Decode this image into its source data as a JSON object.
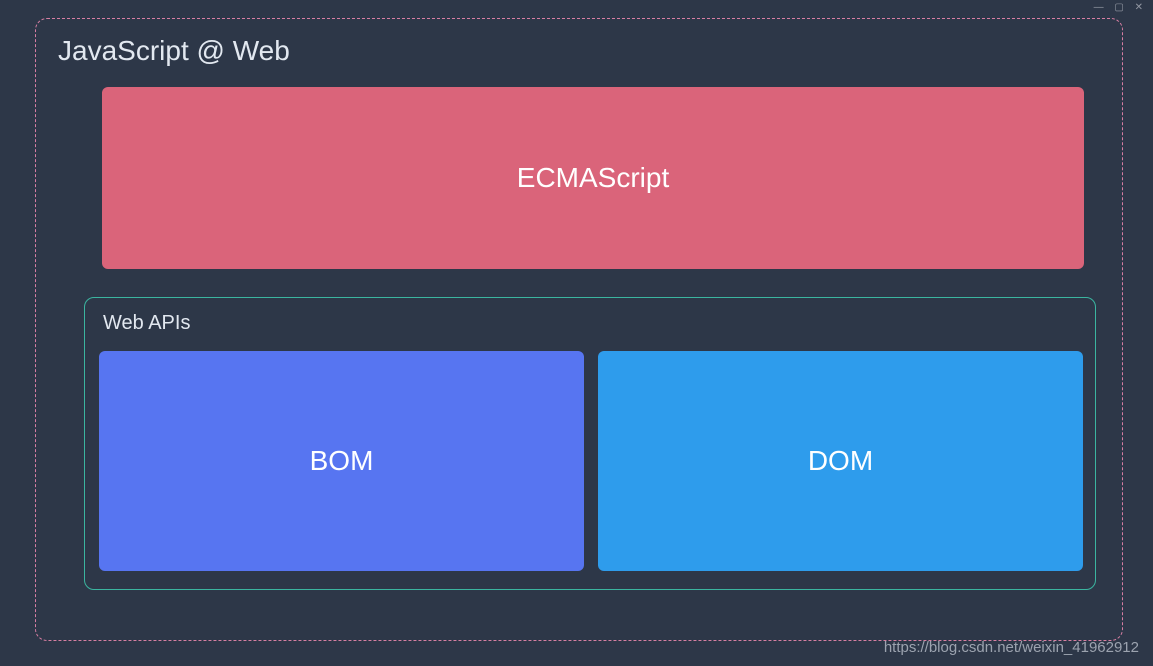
{
  "outer": {
    "title": "JavaScript @ Web"
  },
  "ecmascript": {
    "label": "ECMAScript"
  },
  "webapis": {
    "title": "Web APIs",
    "bom": "BOM",
    "dom": "DOM"
  },
  "watermark": "https://blog.csdn.net/weixin_41962912",
  "windowControls": "— ▢ ✕"
}
